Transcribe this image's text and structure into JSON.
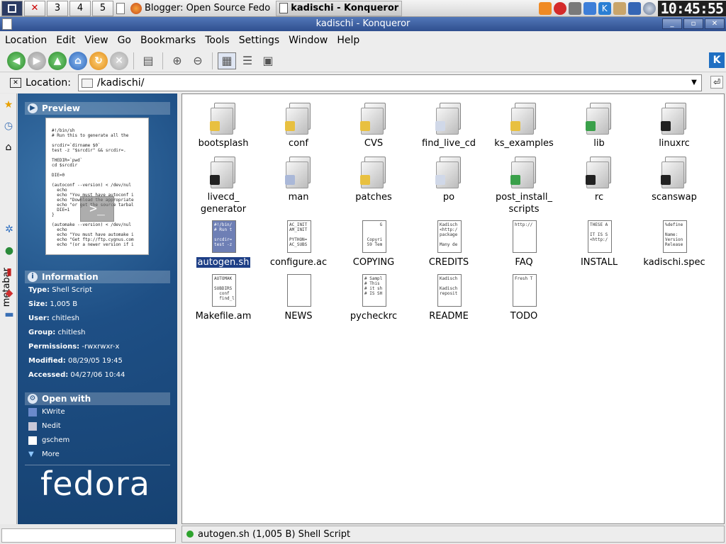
{
  "panel": {
    "desktops": [
      "",
      "",
      "3",
      "4",
      "5"
    ],
    "tasks": [
      {
        "label": "Blogger: Open Source Fedo"
      },
      {
        "label": "kadischi - Konqueror"
      }
    ],
    "clock": "10:45:55"
  },
  "window": {
    "title": "kadischi - Konqueror"
  },
  "menu": [
    "Location",
    "Edit",
    "View",
    "Go",
    "Bookmarks",
    "Tools",
    "Settings",
    "Window",
    "Help"
  ],
  "location": {
    "label": "Location:",
    "value": "/kadischi/"
  },
  "metabar": {
    "tab_label": "metabar"
  },
  "sidebar": {
    "preview_title": "Preview",
    "preview_text": "#!/bin/sh\n# Run this to generate all the\n\nsrcdir=`dirname $0`\ntest -z \"$srcdir\" && srcdir=.\n\nTHEDIR=`pwd`\ncd $srcdir\n\nDIE=0\n\n(autoconf --version) < /dev/nul\n  echo\n  echo \"You must have autoconf i\n  echo \"Download the appropriate\n  echo \"or get the source tarbal\n  DIE=1\n}\n\n(automake --version) < /dev/nul\n  echo\n  echo \"You must have automake i\n  echo \"Get ftp://ftp.cygnus.com\n  echo \"(or a newer version if i",
    "info_title": "Information",
    "info": [
      {
        "key": "Type:",
        "value": "Shell Script"
      },
      {
        "key": "Size:",
        "value": "1,005 B"
      },
      {
        "key": "User:",
        "value": "chitlesh"
      },
      {
        "key": "Group:",
        "value": "chitlesh"
      },
      {
        "key": "Permissions:",
        "value": "-rwxrwxr-x"
      },
      {
        "key": "Modified:",
        "value": "08/29/05 19:45"
      },
      {
        "key": "Accessed:",
        "value": "04/27/06 10:44"
      }
    ],
    "open_title": "Open with",
    "open_with": [
      "KWrite",
      "Nedit",
      "gschem",
      "More"
    ],
    "logo": "fedora"
  },
  "files": [
    {
      "name": "bootsplash",
      "kind": "folder",
      "emblem": "#e8c040"
    },
    {
      "name": "conf",
      "kind": "folder",
      "emblem": "#e8c040"
    },
    {
      "name": "CVS",
      "kind": "folder",
      "emblem": "#e8c040"
    },
    {
      "name": "find_live_cd",
      "kind": "folder",
      "emblem": "#d0d8e8"
    },
    {
      "name": "ks_examples",
      "kind": "folder",
      "emblem": "#e8c040"
    },
    {
      "name": "lib",
      "kind": "folder",
      "emblem": "#3aa04a"
    },
    {
      "name": "linuxrc",
      "kind": "folder",
      "emblem": "#222222"
    },
    {
      "name": "livecd_\ngenerator",
      "kind": "folder",
      "emblem": "#222222"
    },
    {
      "name": "man",
      "kind": "folder",
      "emblem": "#aab8d8"
    },
    {
      "name": "patches",
      "kind": "folder",
      "emblem": "#e8c040"
    },
    {
      "name": "po",
      "kind": "folder",
      "emblem": "#d0d8e8"
    },
    {
      "name": "post_install_\nscripts",
      "kind": "folder",
      "emblem": "#3aa04a"
    },
    {
      "name": "rc",
      "kind": "folder",
      "emblem": "#222222"
    },
    {
      "name": "scanswap",
      "kind": "folder",
      "emblem": "#222222"
    },
    {
      "name": "autogen.sh",
      "kind": "doc",
      "selected": true,
      "snippet": "#!/bin/\n# Run t\n\nsrcdir=\ntest -z"
    },
    {
      "name": "configure.ac",
      "kind": "doc",
      "snippet": "AC_INIT\nAM_INIT\n\nPYTHON=\nAC_SUBS"
    },
    {
      "name": "COPYING",
      "kind": "doc",
      "snippet": "      G\n\n\n Copyri\n 59 Tem"
    },
    {
      "name": "CREDITS",
      "kind": "doc",
      "snippet": "Kadisch\n<http:/\npackage\n\nMany de"
    },
    {
      "name": "FAQ",
      "kind": "doc",
      "snippet": "http://"
    },
    {
      "name": "INSTALL",
      "kind": "doc",
      "snippet": "THESE A\n\nIT IS S\n<http:/"
    },
    {
      "name": "kadischi.spec",
      "kind": "doc",
      "snippet": "%define\n\nName:\nVersion\nRelease"
    },
    {
      "name": "Makefile.am",
      "kind": "doc",
      "snippet": "AUTOMAK\n\nSUBDIRS\n  conf\n  find_l"
    },
    {
      "name": "NEWS",
      "kind": "doc",
      "snippet": ""
    },
    {
      "name": "pycheckrc",
      "kind": "doc",
      "snippet": "# Sampl\n# This\n# it sh\n# IS SH"
    },
    {
      "name": "README",
      "kind": "doc",
      "snippet": "Kadisch\n\nKadisch\nreposit"
    },
    {
      "name": "TODO",
      "kind": "doc",
      "snippet": "Fresh T"
    }
  ],
  "status": {
    "text": "autogen.sh (1,005 B)  Shell Script"
  }
}
